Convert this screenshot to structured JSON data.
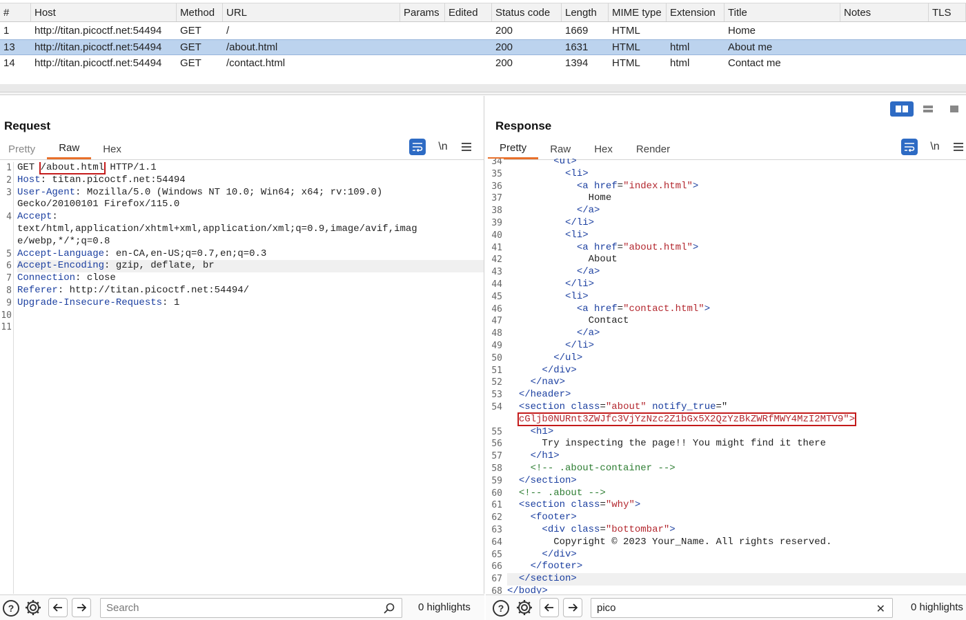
{
  "table": {
    "headers": [
      "#",
      "Host",
      "Method",
      "URL",
      "Params",
      "Edited",
      "Status code",
      "Length",
      "MIME type",
      "Extension",
      "Title",
      "Notes",
      "TLS"
    ],
    "rows": [
      {
        "num": "1",
        "host": "http://titan.picoctf.net:54494",
        "method": "GET",
        "url": "/",
        "status": "200",
        "length": "1669",
        "mime": "HTML",
        "ext": "",
        "title": "Home"
      },
      {
        "num": "13",
        "host": "http://titan.picoctf.net:54494",
        "method": "GET",
        "url": "/about.html",
        "status": "200",
        "length": "1631",
        "mime": "HTML",
        "ext": "html",
        "title": "About me"
      },
      {
        "num": "14",
        "host": "http://titan.picoctf.net:54494",
        "method": "GET",
        "url": "/contact.html",
        "status": "200",
        "length": "1394",
        "mime": "HTML",
        "ext": "html",
        "title": "Contact me"
      }
    ]
  },
  "request": {
    "title": "Request",
    "tabs": [
      "Pretty",
      "Raw",
      "Hex"
    ],
    "active_tab": "Raw",
    "newline_label": "\\n",
    "lines": [
      {
        "n": "1",
        "parts": [
          [
            "",
            "GET "
          ],
          [
            "box",
            "/about.html"
          ],
          [
            "",
            " HTTP/1.1"
          ]
        ]
      },
      {
        "n": "2",
        "parts": [
          [
            "k",
            "Host"
          ],
          [
            "",
            ": titan.picoctf.net:54494"
          ]
        ]
      },
      {
        "n": "3",
        "parts": [
          [
            "k",
            "User-Agent"
          ],
          [
            "",
            ": Mozilla/5.0 (Windows NT 10.0; Win64; x64; rv:109.0)"
          ]
        ]
      },
      {
        "n": "",
        "parts": [
          [
            "",
            "Gecko/20100101 Firefox/115.0"
          ]
        ]
      },
      {
        "n": "4",
        "parts": [
          [
            "k",
            "Accept"
          ],
          [
            "",
            ":"
          ]
        ]
      },
      {
        "n": "",
        "parts": [
          [
            "",
            "text/html,application/xhtml+xml,application/xml;q=0.9,image/avif,imag"
          ]
        ]
      },
      {
        "n": "",
        "parts": [
          [
            "",
            "e/webp,*/*;q=0.8"
          ]
        ]
      },
      {
        "n": "5",
        "parts": [
          [
            "k",
            "Accept-Language"
          ],
          [
            "",
            ": en-CA,en-US;q=0.7,en;q=0.3"
          ]
        ]
      },
      {
        "n": "6",
        "hl": true,
        "parts": [
          [
            "k",
            "Accept-Encoding"
          ],
          [
            "",
            ": gzip, deflate, br"
          ]
        ]
      },
      {
        "n": "7",
        "parts": [
          [
            "k",
            "Connection"
          ],
          [
            "",
            ": close"
          ]
        ]
      },
      {
        "n": "8",
        "parts": [
          [
            "k",
            "Referer"
          ],
          [
            "",
            ": http://titan.picoctf.net:54494/"
          ]
        ]
      },
      {
        "n": "9",
        "parts": [
          [
            "k",
            "Upgrade-Insecure-Requests"
          ],
          [
            "",
            ": 1"
          ]
        ]
      },
      {
        "n": "10",
        "parts": []
      },
      {
        "n": "11",
        "parts": []
      }
    ],
    "search_placeholder": "Search",
    "highlights": "0 highlights"
  },
  "response": {
    "title": "Response",
    "tabs": [
      "Pretty",
      "Raw",
      "Hex",
      "Render"
    ],
    "active_tab": "Pretty",
    "newline_label": "\\n",
    "lines": [
      {
        "n": "34",
        "parts": [
          [
            "",
            "        "
          ],
          [
            "tag",
            "<ul>"
          ]
        ]
      },
      {
        "n": "35",
        "parts": [
          [
            "",
            "          "
          ],
          [
            "tag",
            "<li>"
          ]
        ]
      },
      {
        "n": "36",
        "parts": [
          [
            "",
            "            "
          ],
          [
            "tag",
            "<a "
          ],
          [
            "attr",
            "href"
          ],
          [
            "",
            "="
          ],
          [
            "str",
            "\"index.html\""
          ],
          [
            "tag",
            ">"
          ]
        ]
      },
      {
        "n": "37",
        "parts": [
          [
            "",
            "              Home"
          ]
        ]
      },
      {
        "n": "38",
        "parts": [
          [
            "",
            "            "
          ],
          [
            "tag",
            "</a>"
          ]
        ]
      },
      {
        "n": "39",
        "parts": [
          [
            "",
            "          "
          ],
          [
            "tag",
            "</li>"
          ]
        ]
      },
      {
        "n": "40",
        "parts": [
          [
            "",
            "          "
          ],
          [
            "tag",
            "<li>"
          ]
        ]
      },
      {
        "n": "41",
        "parts": [
          [
            "",
            "            "
          ],
          [
            "tag",
            "<a "
          ],
          [
            "attr",
            "href"
          ],
          [
            "",
            "="
          ],
          [
            "str",
            "\"about.html\""
          ],
          [
            "tag",
            ">"
          ]
        ]
      },
      {
        "n": "42",
        "parts": [
          [
            "",
            "              About"
          ]
        ]
      },
      {
        "n": "43",
        "parts": [
          [
            "",
            "            "
          ],
          [
            "tag",
            "</a>"
          ]
        ]
      },
      {
        "n": "44",
        "parts": [
          [
            "",
            "          "
          ],
          [
            "tag",
            "</li>"
          ]
        ]
      },
      {
        "n": "45",
        "parts": [
          [
            "",
            "          "
          ],
          [
            "tag",
            "<li>"
          ]
        ]
      },
      {
        "n": "46",
        "parts": [
          [
            "",
            "            "
          ],
          [
            "tag",
            "<a "
          ],
          [
            "attr",
            "href"
          ],
          [
            "",
            "="
          ],
          [
            "str",
            "\"contact.html\""
          ],
          [
            "tag",
            ">"
          ]
        ]
      },
      {
        "n": "47",
        "parts": [
          [
            "",
            "              Contact"
          ]
        ]
      },
      {
        "n": "48",
        "parts": [
          [
            "",
            "            "
          ],
          [
            "tag",
            "</a>"
          ]
        ]
      },
      {
        "n": "49",
        "parts": [
          [
            "",
            "          "
          ],
          [
            "tag",
            "</li>"
          ]
        ]
      },
      {
        "n": "50",
        "parts": [
          [
            "",
            "        "
          ],
          [
            "tag",
            "</ul>"
          ]
        ]
      },
      {
        "n": "51",
        "parts": [
          [
            "",
            "      "
          ],
          [
            "tag",
            "</div>"
          ]
        ]
      },
      {
        "n": "52",
        "parts": [
          [
            "",
            "    "
          ],
          [
            "tag",
            "</nav>"
          ]
        ]
      },
      {
        "n": "53",
        "parts": [
          [
            "",
            "  "
          ],
          [
            "tag",
            "</header>"
          ]
        ]
      },
      {
        "n": "54",
        "parts": [
          [
            "",
            "  "
          ],
          [
            "tag",
            "<section "
          ],
          [
            "attr",
            "class"
          ],
          [
            "",
            "="
          ],
          [
            "str",
            "\"about\""
          ],
          [
            "",
            " "
          ],
          [
            "attr",
            "notify_true"
          ],
          [
            "",
            "=\""
          ]
        ]
      },
      {
        "n": "",
        "parts": [
          [
            "",
            "  "
          ],
          [
            "strbox",
            "cGljb0NURnt3ZWJfc3VjYzNzc2Z1bGx5X2QzYzBkZWRfMWY4MzI2MTV9\">"
          ]
        ]
      },
      {
        "n": "55",
        "parts": [
          [
            "",
            "    "
          ],
          [
            "tag",
            "<h1>"
          ]
        ]
      },
      {
        "n": "56",
        "parts": [
          [
            "",
            "      Try inspecting the page!! You might find it there"
          ]
        ]
      },
      {
        "n": "57",
        "parts": [
          [
            "",
            "    "
          ],
          [
            "tag",
            "</h1>"
          ]
        ]
      },
      {
        "n": "58",
        "parts": [
          [
            "",
            "    "
          ],
          [
            "cmt",
            "<!-- .about-container -->"
          ]
        ]
      },
      {
        "n": "59",
        "parts": [
          [
            "",
            "  "
          ],
          [
            "tag",
            "</section>"
          ]
        ]
      },
      {
        "n": "60",
        "parts": [
          [
            "",
            "  "
          ],
          [
            "cmt",
            "<!-- .about -->"
          ]
        ]
      },
      {
        "n": "61",
        "parts": [
          [
            "",
            "  "
          ],
          [
            "tag",
            "<section "
          ],
          [
            "attr",
            "class"
          ],
          [
            "",
            "="
          ],
          [
            "str",
            "\"why\""
          ],
          [
            "tag",
            ">"
          ]
        ]
      },
      {
        "n": "62",
        "parts": [
          [
            "",
            "    "
          ],
          [
            "tag",
            "<footer>"
          ]
        ]
      },
      {
        "n": "63",
        "parts": [
          [
            "",
            "      "
          ],
          [
            "tag",
            "<div "
          ],
          [
            "attr",
            "class"
          ],
          [
            "",
            "="
          ],
          [
            "str",
            "\"bottombar\""
          ],
          [
            "tag",
            ">"
          ]
        ]
      },
      {
        "n": "64",
        "parts": [
          [
            "",
            "        Copyright © 2023 Your_Name. All rights reserved."
          ]
        ]
      },
      {
        "n": "65",
        "parts": [
          [
            "",
            "      "
          ],
          [
            "tag",
            "</div>"
          ]
        ]
      },
      {
        "n": "66",
        "parts": [
          [
            "",
            "    "
          ],
          [
            "tag",
            "</footer>"
          ]
        ]
      },
      {
        "n": "67",
        "hl": true,
        "parts": [
          [
            "",
            "  "
          ],
          [
            "tag",
            "</section>"
          ]
        ]
      },
      {
        "n": "68",
        "parts": [
          [
            "",
            ""
          ],
          [
            "tag",
            "</body>"
          ]
        ]
      }
    ],
    "search_value": "pico",
    "highlights": "0 highlights"
  },
  "icons": {
    "help": "help-icon",
    "settings": "gear-icon",
    "back": "arrow-left-icon",
    "forward": "arrow-right-icon",
    "search": "search-icon",
    "clear": "close-icon",
    "menu": "hamburger-menu-icon",
    "wrap": "word-wrap-icon"
  },
  "colors": {
    "accent": "#2e6bc4",
    "tab_underline": "#e8702a",
    "selected_row": "#bcd3ee",
    "highlight_box": "#c41a1a"
  }
}
